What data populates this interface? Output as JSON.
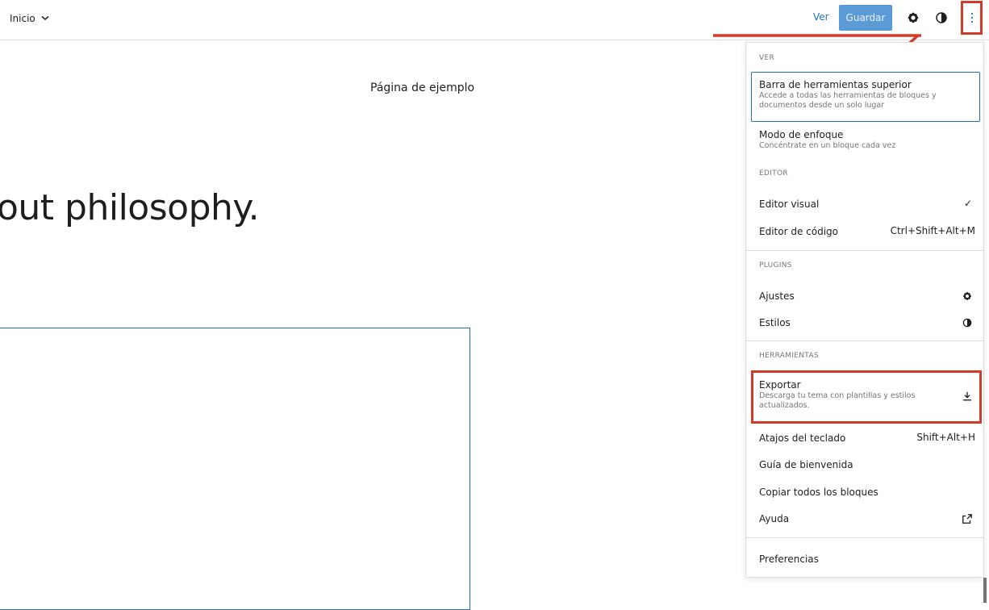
{
  "topbar": {
    "page_select_label": "Inicio",
    "ver_label": "Ver",
    "guardar_label": "Guardar",
    "icons": [
      "settings-icon",
      "styles-icon",
      "more-options-icon"
    ]
  },
  "canvas": {
    "page_title": "Página de ejemplo",
    "hero_text": "out philosophy."
  },
  "menu": {
    "sections": {
      "ver": "VER",
      "editor": "EDITOR",
      "plugins": "PLUGINS",
      "herramientas": "HERRAMIENTAS"
    },
    "barra": {
      "title": "Barra de herramientas superior",
      "desc": "Accede a todas las herramientas de bloques y documentos desde un solo lugar"
    },
    "enfoque": {
      "title": "Modo de enfoque",
      "desc": "Concéntrate en un bloque cada vez"
    },
    "editor_visual": {
      "title": "Editor visual",
      "check": "✓"
    },
    "editor_codigo": {
      "title": "Editor de código",
      "shortcut": "Ctrl+Shift+Alt+M"
    },
    "ajustes": {
      "title": "Ajustes",
      "icon": "settings-icon"
    },
    "estilos": {
      "title": "Estilos",
      "icon": "styles-icon"
    },
    "exportar": {
      "title": "Exportar",
      "desc": "Descarga tu tema con plantillas y estilos actualizados.",
      "icon": "download-icon"
    },
    "atajos": {
      "title": "Atajos del teclado",
      "shortcut": "Shift+Alt+H"
    },
    "guia": {
      "title": "Guía de bienvenida"
    },
    "copiar": {
      "title": "Copiar todos los bloques"
    },
    "ayuda": {
      "title": "Ayuda",
      "icon": "external-link-icon"
    },
    "preferencias": {
      "title": "Preferencias"
    }
  },
  "colors": {
    "accent": "#2271b1",
    "guardar_bg": "#5b9bd5",
    "annotation_red": "#d13b2a"
  }
}
